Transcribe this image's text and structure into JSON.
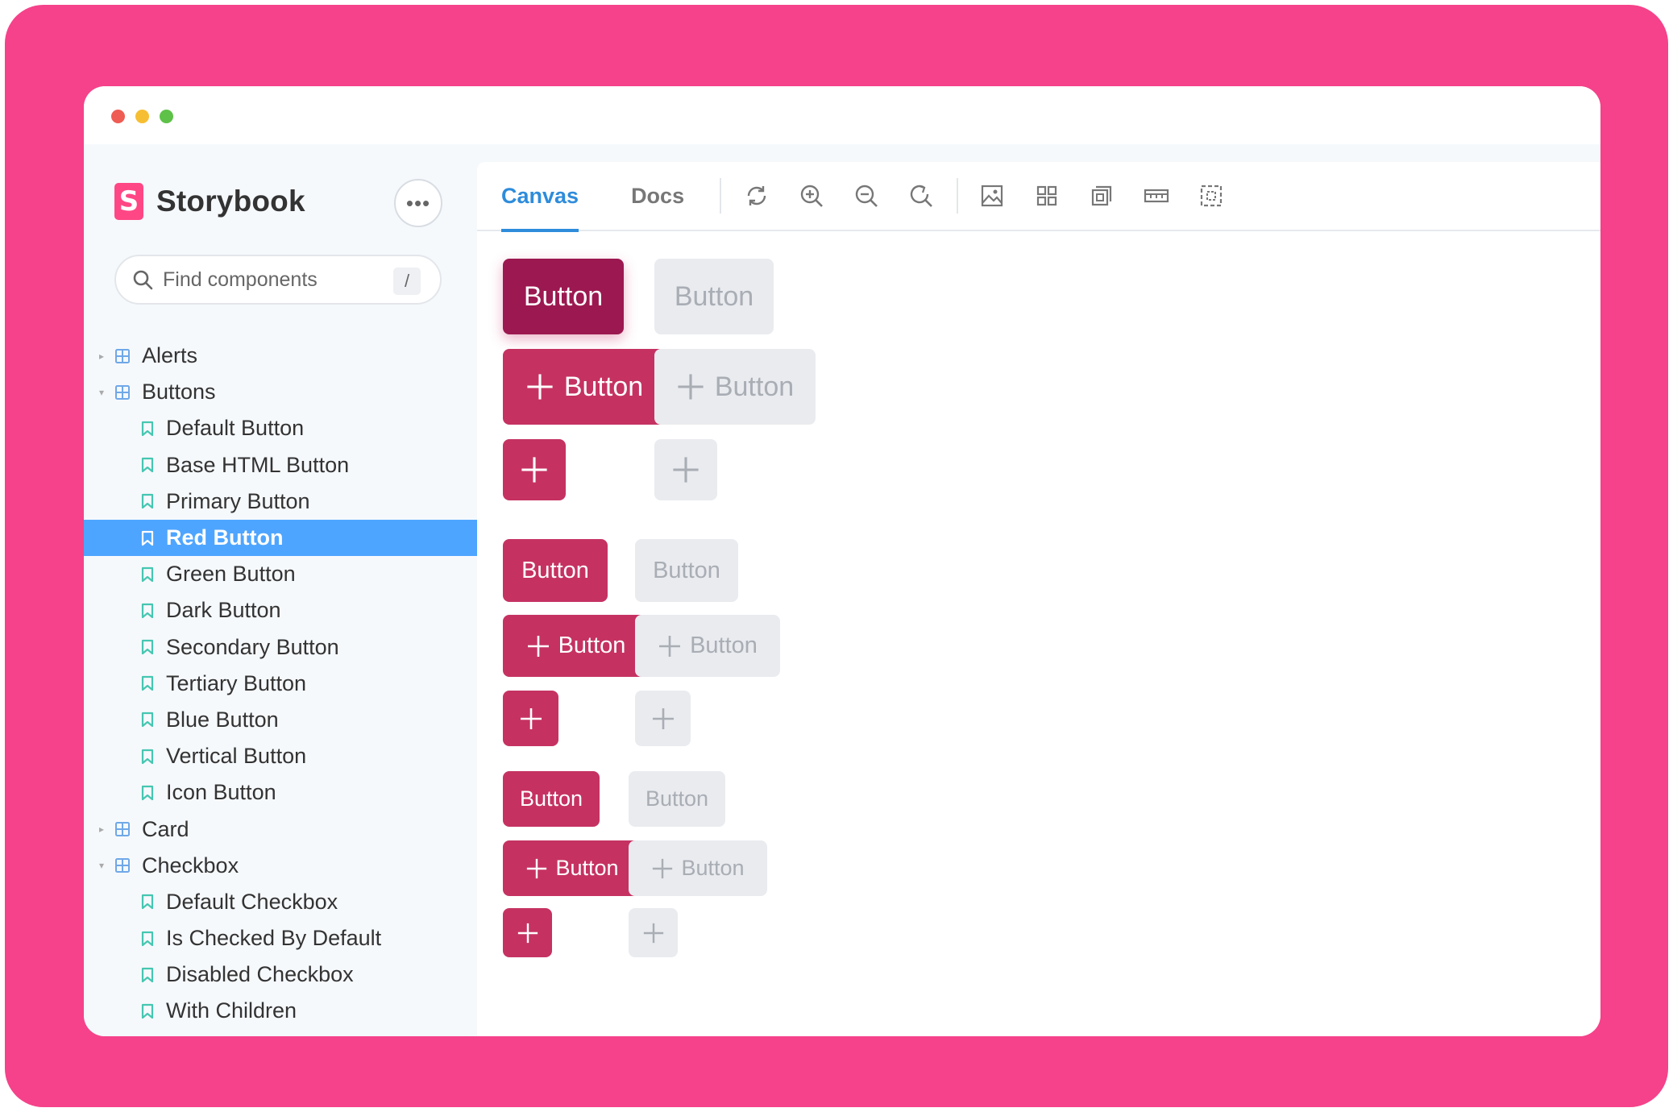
{
  "window": {
    "title": ""
  },
  "sidebar": {
    "brand": "Storybook",
    "menu_label": "•••",
    "search": {
      "placeholder": "Find components",
      "shortcut": "/"
    },
    "tree": [
      {
        "type": "group",
        "label": "Alerts",
        "expanded": false
      },
      {
        "type": "group",
        "label": "Buttons",
        "expanded": true
      },
      {
        "type": "story",
        "label": "Default Button"
      },
      {
        "type": "story",
        "label": "Base HTML Button"
      },
      {
        "type": "story",
        "label": "Primary Button"
      },
      {
        "type": "story",
        "label": "Red Button",
        "selected": true
      },
      {
        "type": "story",
        "label": "Green Button"
      },
      {
        "type": "story",
        "label": "Dark Button"
      },
      {
        "type": "story",
        "label": "Secondary Button"
      },
      {
        "type": "story",
        "label": "Tertiary Button"
      },
      {
        "type": "story",
        "label": "Blue Button"
      },
      {
        "type": "story",
        "label": "Vertical Button"
      },
      {
        "type": "story",
        "label": "Icon Button"
      },
      {
        "type": "group",
        "label": "Card",
        "expanded": false
      },
      {
        "type": "group",
        "label": "Checkbox",
        "expanded": true
      },
      {
        "type": "story",
        "label": "Default Checkbox"
      },
      {
        "type": "story",
        "label": "Is Checked By Default"
      },
      {
        "type": "story",
        "label": "Disabled Checkbox"
      },
      {
        "type": "story",
        "label": "With Children"
      }
    ]
  },
  "toolbar": {
    "tabs": [
      {
        "label": "Canvas",
        "active": true
      },
      {
        "label": "Docs",
        "active": false
      }
    ],
    "tools": [
      "refresh-icon",
      "zoom-in-icon",
      "zoom-out-icon",
      "zoom-reset-icon",
      "background-icon",
      "grid-icon",
      "outline-icon",
      "measure-icon",
      "viewport-icon"
    ]
  },
  "canvas": {
    "button_label": "Button",
    "sizes": [
      "large",
      "medium",
      "small"
    ]
  },
  "colors": {
    "frame": "#f5428a",
    "brand": "#ff4785",
    "selected": "#4ea5ff",
    "accent": "#2e8cdb",
    "button": "#c53262",
    "button_pressed": "#9c1850",
    "button_disabled": "#e9ebef"
  }
}
